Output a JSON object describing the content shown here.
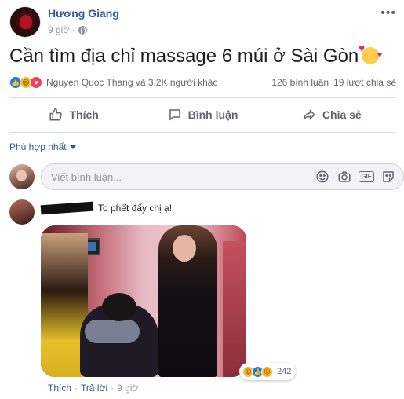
{
  "post": {
    "author": "Hương Giang",
    "time": "9 giờ",
    "text": "Cần tìm địa chỉ massage 6 múi ở Sài Gòn"
  },
  "reactions": {
    "icons": [
      "like-icon",
      "haha-icon",
      "love-icon"
    ],
    "summary": "Nguyen Quoc Thang và 3,2K người khác",
    "comments_count": "126 bình luận",
    "shares_count": "19 lượt chia sẻ"
  },
  "actions": {
    "like": "Thích",
    "comment": "Bình luận",
    "share": "Chia sẻ"
  },
  "sort": {
    "label": "Phù hợp nhất"
  },
  "composer": {
    "placeholder": "Viết bình luận..."
  },
  "comment": {
    "text": "To phết đấy chị ạ!",
    "reaction_count": "242",
    "like_label": "Thích",
    "reply_label": "Trả lời",
    "time": "9 giờ",
    "separator": "·"
  },
  "colors": {
    "link": "#385898",
    "brand": "#1877f2",
    "muted": "#90949c"
  }
}
